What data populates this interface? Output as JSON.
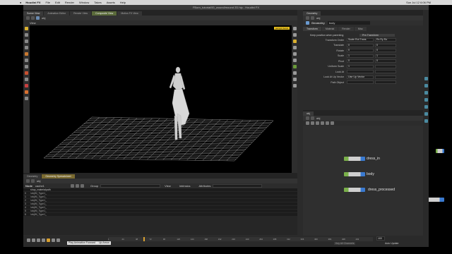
{
  "mac": {
    "app_name": "Houdini FX",
    "menus": [
      "File",
      "Edit",
      "Render",
      "Window",
      "Takes",
      "Assets",
      "Help"
    ],
    "status": "Sun Jul 12  6:06 PM"
  },
  "window": {
    "title": "FBorn_tutorial/00_wound/mound 2D.hip - Houdini FX"
  },
  "left_tabs": [
    "Scene View",
    "Animation Editor",
    "Render View",
    "Composite View",
    "Motion FX View"
  ],
  "viewport": {
    "nav_path": "obj",
    "label": "View",
    "camera_label": "persp1  Cam1"
  },
  "params": {
    "tab": "Geometry",
    "node_type": "Geometry",
    "node_name": "body",
    "subtabs": [
      "Transform",
      "Material",
      "Render",
      "Misc"
    ],
    "keep_pos": "Keep position when parenting",
    "keep_pos_value": "Pre-Transform",
    "rows": [
      {
        "label": "Transform Order",
        "v1": "Scale Rot Trans",
        "v2": "Rx Ry Rz"
      },
      {
        "label": "Translate",
        "v1": "0",
        "v2": "0"
      },
      {
        "label": "Rotate",
        "v1": "0",
        "v2": "0"
      },
      {
        "label": "Scale",
        "v1": "1",
        "v2": "1"
      },
      {
        "label": "Pivot",
        "v1": "0",
        "v2": "0"
      },
      {
        "label": "Uniform Scale",
        "v1": "1",
        "v2": ""
      },
      {
        "label": "Look At",
        "v1": "",
        "v2": ""
      },
      {
        "label": "Look At Up Vector",
        "v1": "Use Up Vector",
        "v2": ""
      },
      {
        "label": "Path Object",
        "v1": "",
        "v2": ""
      }
    ]
  },
  "network": {
    "path": "obj",
    "nodes": [
      {
        "name": "dress_in"
      },
      {
        "name": "body"
      },
      {
        "name": "dress_processed"
      }
    ]
  },
  "spreadsheet": {
    "tabs": [
      "Geometry",
      "Geometry Spreadsheet"
    ],
    "node_label": "Node",
    "node_value": "cache1",
    "group_label": "Group",
    "view_label": "View",
    "intrinsics_label": "Intrinsics",
    "attributes_label": "Attributes",
    "header": [
      "",
      "shop_materialpath"
    ],
    "rows": [
      [
        "0",
        "/obj/M_Type1_"
      ],
      [
        "1",
        "/obj/M_Type1_"
      ],
      [
        "2",
        "/obj/M_Type1_"
      ],
      [
        "3",
        "/obj/M_Type1_"
      ],
      [
        "4",
        "/obj/M_Type1_"
      ],
      [
        "5",
        "/obj/M_Type1_"
      ],
      [
        "6",
        "/obj/M_Type1_"
      ]
    ]
  },
  "timeline": {
    "frame_start": "1",
    "frame_current": "1",
    "frame_end": "465",
    "tooltip": "Play Animation Forward",
    "tooltip_key": "Up Arrow",
    "ticks": [
      "1",
      "24",
      "48",
      "72",
      "96",
      "120",
      "144",
      "168",
      "192",
      "216",
      "240",
      "264",
      "288",
      "312",
      "336",
      "360",
      "384",
      "408",
      "432"
    ],
    "end_value": "465",
    "auto_update": "Auto Update",
    "keys_label": "0 keys, 0/0 channels",
    "key_all": "Key All Channels"
  },
  "colors": {
    "grid": "#9a9a9a",
    "accent_node": "#7ab04a",
    "blue_node": "#3a7ad0"
  }
}
